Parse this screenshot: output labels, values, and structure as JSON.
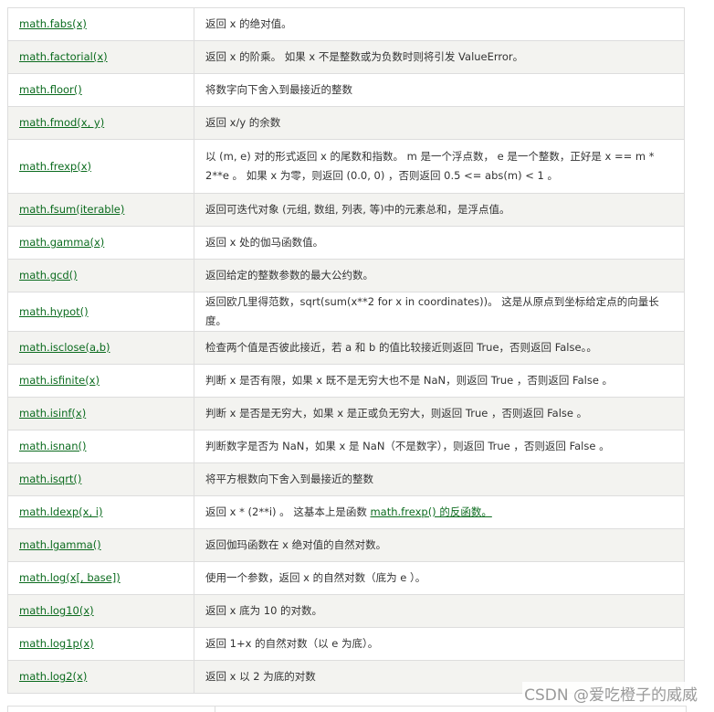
{
  "rows": [
    {
      "func": "math.fabs(x)",
      "desc": "返回 x 的绝对值。"
    },
    {
      "func": "math.factorial(x)",
      "desc": "返回 x 的阶乘。 如果 x 不是整数或为负数时则将引发 ValueError。"
    },
    {
      "func": "math.floor()",
      "desc": "将数字向下舍入到最接近的整数"
    },
    {
      "func": "math.fmod(x, y)",
      "desc": "返回 x/y 的余数"
    },
    {
      "func": "math.frexp(x)",
      "desc": "以 (m, e) 对的形式返回 x 的尾数和指数。 m 是一个浮点数， e 是一个整数，正好是 x == m * 2**e 。 如果 x 为零，则返回 (0.0, 0) ，否则返回 0.5 <= abs(m) < 1 。"
    },
    {
      "func": "math.fsum(iterable)",
      "desc": "返回可迭代对象 (元组, 数组, 列表, 等)中的元素总和，是浮点值。"
    },
    {
      "func": "math.gamma(x)",
      "desc": "返回 x 处的伽马函数值。"
    },
    {
      "func": "math.gcd()",
      "desc": "返回给定的整数参数的最大公约数。"
    },
    {
      "func": "math.hypot()",
      "desc": "返回欧几里得范数，sqrt(sum(x**2 for x in coordinates))。 这是从原点到坐标给定点的向量长度。"
    },
    {
      "func": "math.isclose(a,b)",
      "desc": "检查两个值是否彼此接近，若 a 和 b 的值比较接近则返回 True，否则返回 False。。"
    },
    {
      "func": "math.isfinite(x)",
      "desc": "判断 x 是否有限，如果 x 既不是无穷大也不是 NaN，则返回 True ，否则返回 False 。"
    },
    {
      "func": "math.isinf(x)",
      "desc": "判断 x 是否是无穷大，如果 x 是正或负无穷大，则返回 True ，否则返回 False 。"
    },
    {
      "func": "math.isnan()",
      "desc": "判断数字是否为 NaN，如果 x 是 NaN（不是数字），则返回 True ，否则返回 False 。"
    },
    {
      "func": "math.isqrt()",
      "desc": "将平方根数向下舍入到最接近的整数"
    },
    {
      "func": "math.ldexp(x, i)",
      "desc": "返回 x * (2**i) 。 这基本上是函数 ",
      "link": "math.frexp() 的反函数。"
    },
    {
      "func": "math.lgamma()",
      "desc": "返回伽玛函数在 x 绝对值的自然对数。"
    },
    {
      "func": "math.log(x[, base])",
      "desc": "使用一个参数，返回 x 的自然对数（底为 e ）。"
    },
    {
      "func": "math.log10(x)",
      "desc": "返回 x 底为 10 的对数。"
    },
    {
      "func": "math.log1p(x)",
      "desc": "返回 1+x 的自然对数（以 e 为底）。"
    },
    {
      "func": "math.log2(x)",
      "desc": "返回 x 以 2 为底的对数"
    }
  ],
  "watermark": "CSDN @爱吃橙子的威威",
  "colors": {
    "link": "#0b6b1e",
    "row_alt": "#f3f3f0",
    "border": "#dddddd"
  }
}
